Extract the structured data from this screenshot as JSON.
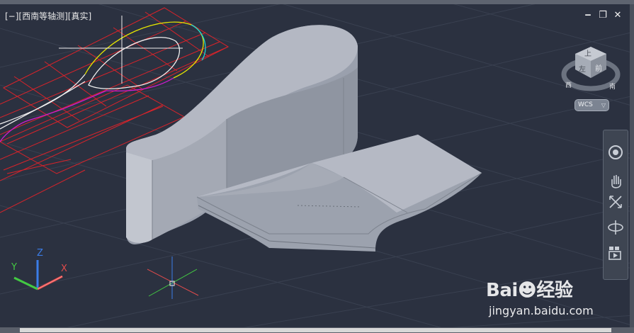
{
  "viewport": {
    "label": "[−][西南等轴测][真实]",
    "background": "#2b3140",
    "grid_color": "#3a4050",
    "window_controls": {
      "minimize": "‒",
      "restore": "❐",
      "close": "✕"
    }
  },
  "viewcube": {
    "top_face_label": "上",
    "front_face_label": "左",
    "right_face_label": "前",
    "compass_west": "西",
    "compass_south": "南"
  },
  "wcs_menu": {
    "label": "WCS",
    "caret": "▽"
  },
  "ucs_icon": {
    "x_label": "X",
    "y_label": "Y",
    "z_label": "Z"
  },
  "navigation_bar": {
    "tools": [
      "steering-wheel",
      "pan",
      "zoom-extents",
      "orbit",
      "showmotion"
    ]
  },
  "watermark": {
    "logo_text": "Bai☻经验",
    "url": "jingyan.baidu.com"
  },
  "colors": {
    "profile_red": "#d8232a",
    "spline_white": "#f0f0f0",
    "solid_face": "#a9aebb",
    "solid_side": "#8c919c",
    "axis_x": "#e04b4b",
    "axis_y": "#43c943",
    "axis_z": "#3b7de8"
  }
}
